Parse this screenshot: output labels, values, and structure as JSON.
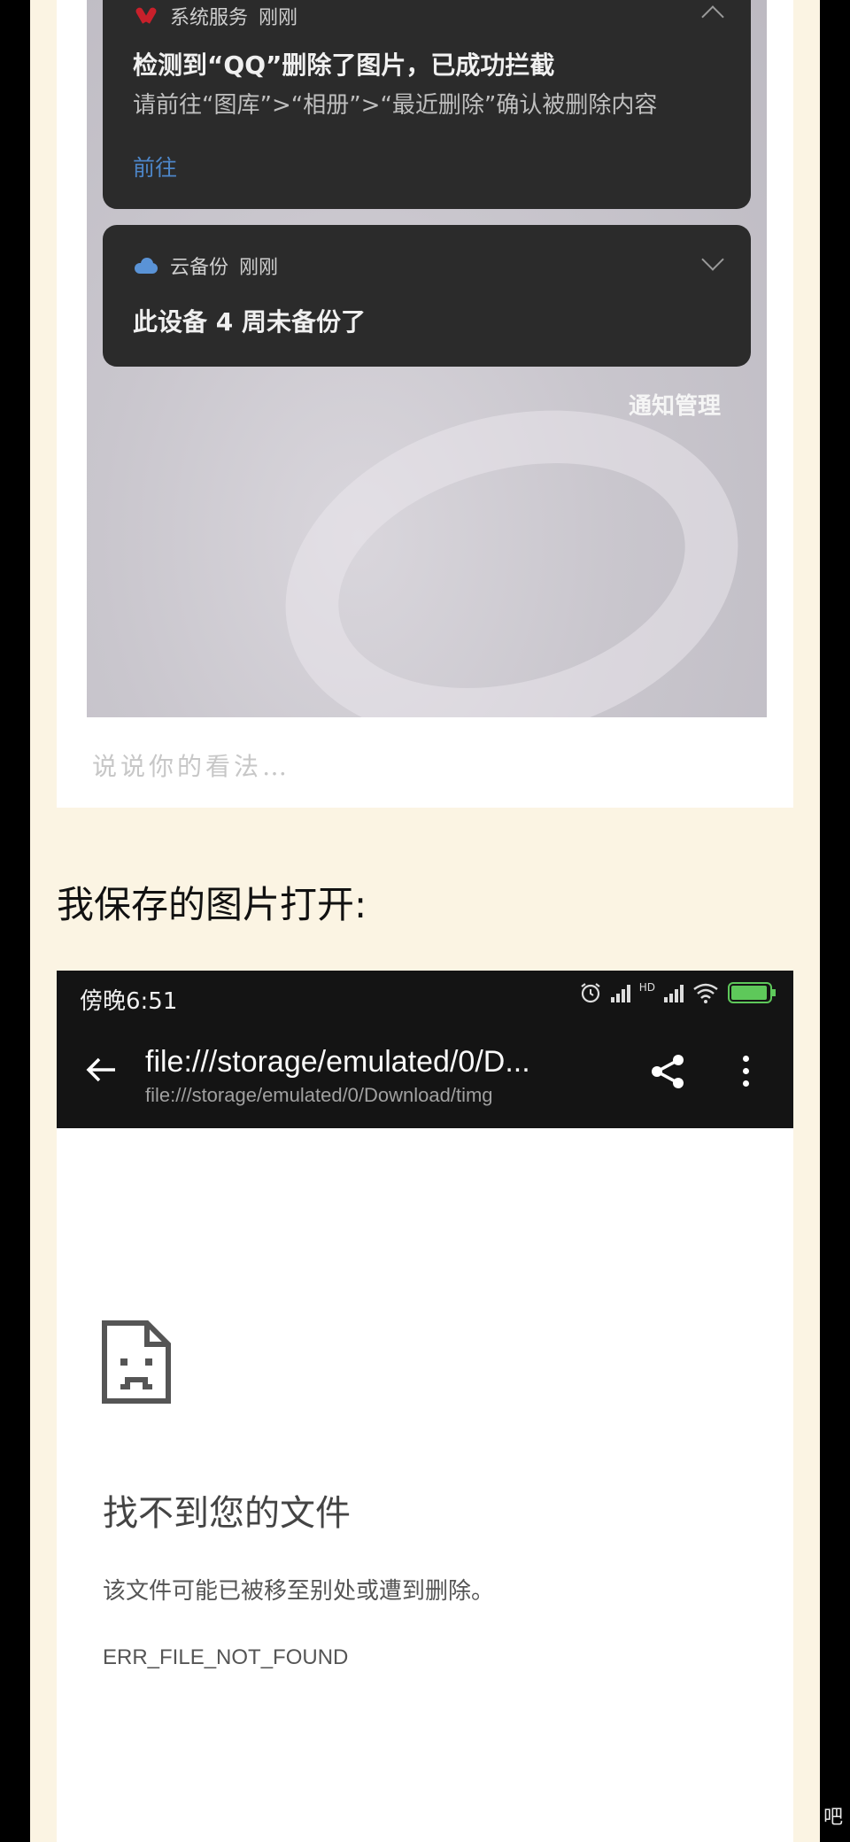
{
  "notification_screenshot": {
    "card1": {
      "app": "系统服务",
      "time": "刚刚",
      "title": "检测到“QQ”删除了图片，已成功拦截",
      "body": "请前往“图库”>“相册”>“最近删除”确认被删除内容",
      "link": "前往"
    },
    "card2": {
      "app": "云备份",
      "time": "刚刚",
      "title": "此设备 4 周未备份了"
    },
    "manage": "通知管理",
    "comment_placeholder": "说说你的看法…"
  },
  "caption": "我保存的图片打开:",
  "browser_screenshot": {
    "status_time": "傍晚6:51",
    "status_hd": "HD",
    "url_main": "file:///storage/emulated/0/D...",
    "url_sub": "file:///storage/emulated/0/Download/timg",
    "error": {
      "title": "找不到您的文件",
      "description": "该文件可能已被移至别处或遭到删除。",
      "code": "ERR_FILE_NOT_FOUND"
    }
  },
  "watermark": "吧",
  "colors": {
    "page_bg": "#fbf4e3",
    "card_bg": "#2b2b2b",
    "link": "#4d86c8",
    "battery": "#5ec85a"
  }
}
